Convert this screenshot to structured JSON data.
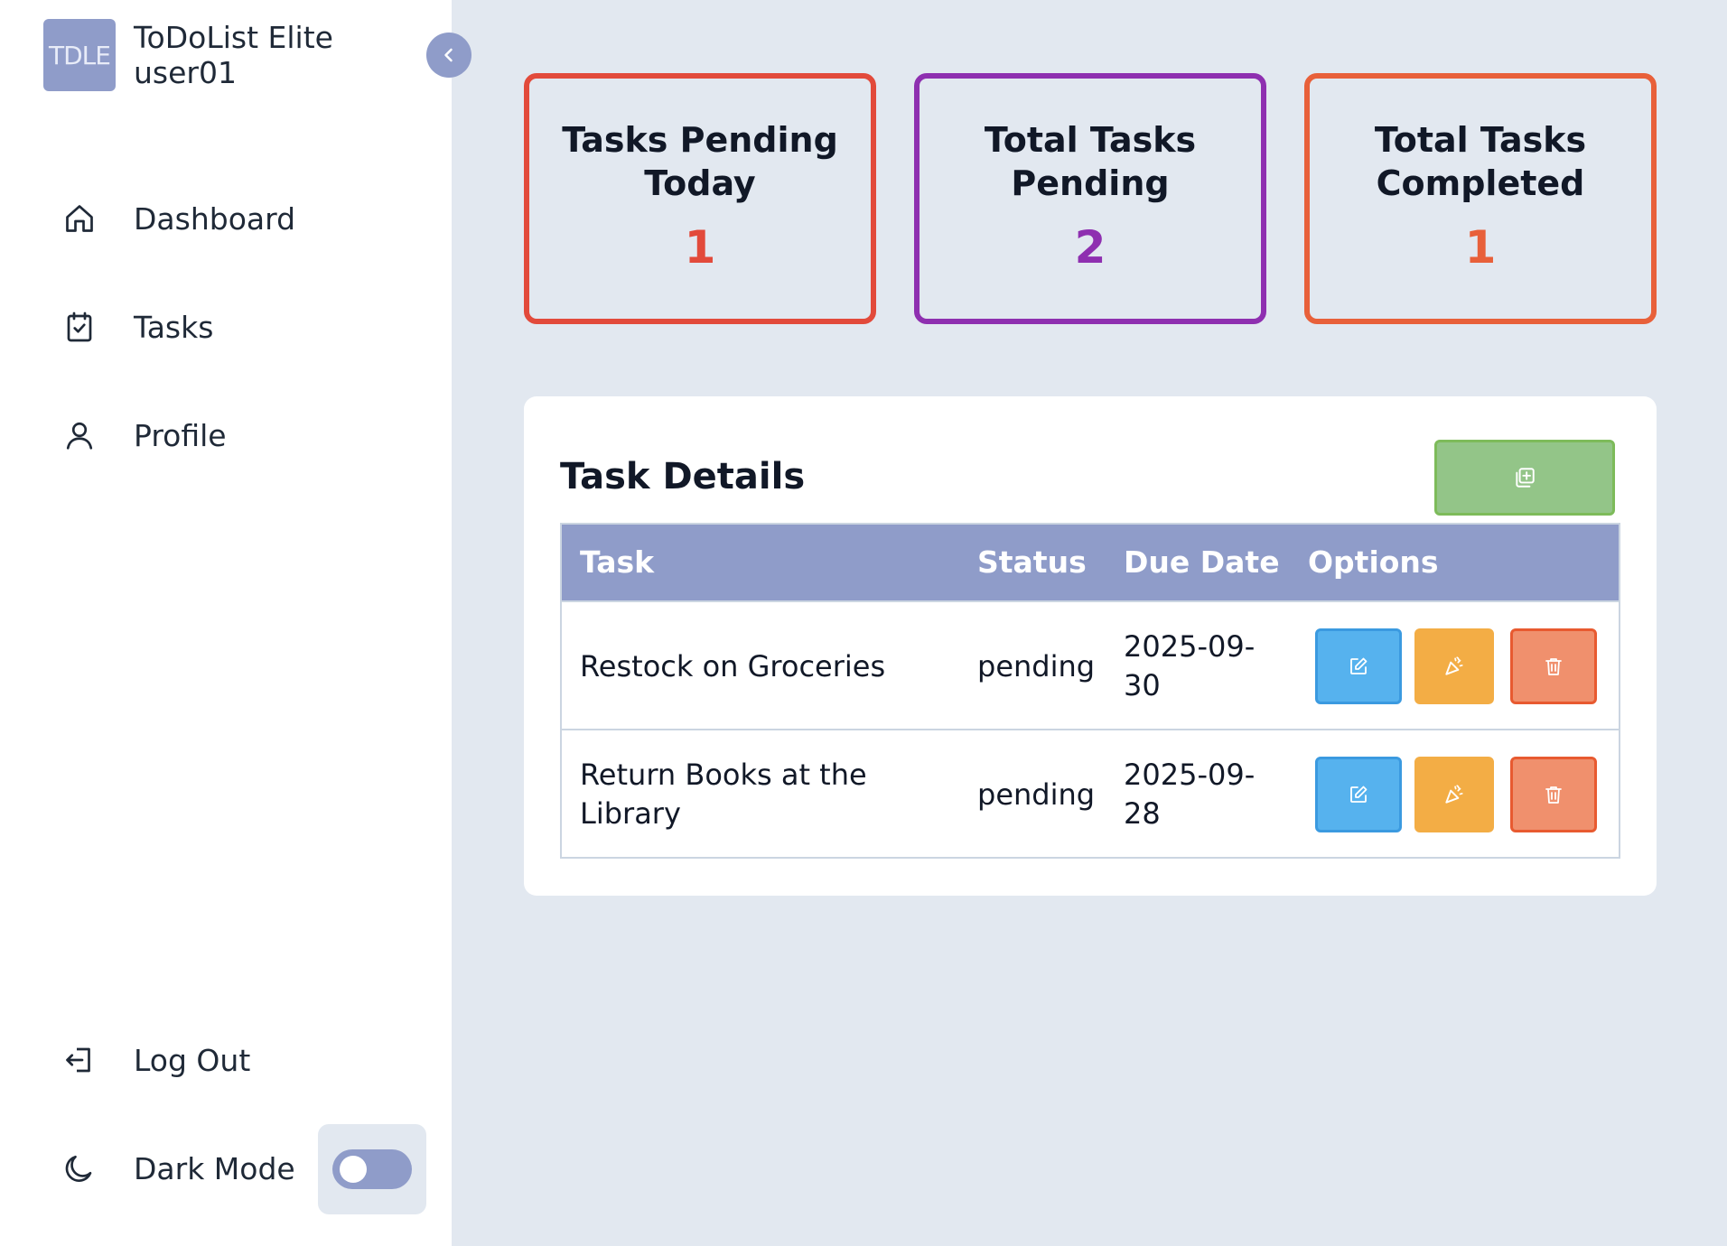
{
  "sidebar": {
    "logo_text": "TDLE",
    "app_name": "ToDoList Elite",
    "username": "user01",
    "nav": [
      {
        "label": "Dashboard",
        "icon": "home-icon"
      },
      {
        "label": "Tasks",
        "icon": "clipboard-check-icon"
      },
      {
        "label": "Profile",
        "icon": "user-icon"
      }
    ],
    "logout_label": "Log Out",
    "dark_mode_label": "Dark Mode",
    "dark_mode_on": false
  },
  "stats": [
    {
      "title": "Tasks Pending\nToday",
      "value": "1",
      "color": "#e24a3b"
    },
    {
      "title": "Total Tasks\nPending",
      "value": "2",
      "color": "#8e2fb0"
    },
    {
      "title": "Total Tasks\nCompleted",
      "value": "1",
      "color": "#e8603a"
    }
  ],
  "task_panel": {
    "title": "Task Details",
    "add_button_icon": "add-copy-icon",
    "columns": [
      "Task",
      "Status",
      "Due Date",
      "Options"
    ],
    "rows": [
      {
        "task": "Restock on Groceries",
        "status": "pending",
        "due_line1": "2025-09-",
        "due_line2": "30"
      },
      {
        "task_line1": "Return Books at the",
        "task_line2": "Library",
        "status": "pending",
        "due_line1": "2025-09-",
        "due_line2": "28"
      }
    ]
  },
  "colors": {
    "accent": "#8f9cc9",
    "edit": "#56b2ee",
    "complete": "#f3ad45",
    "delete": "#f0906d",
    "add": "#93c588"
  }
}
